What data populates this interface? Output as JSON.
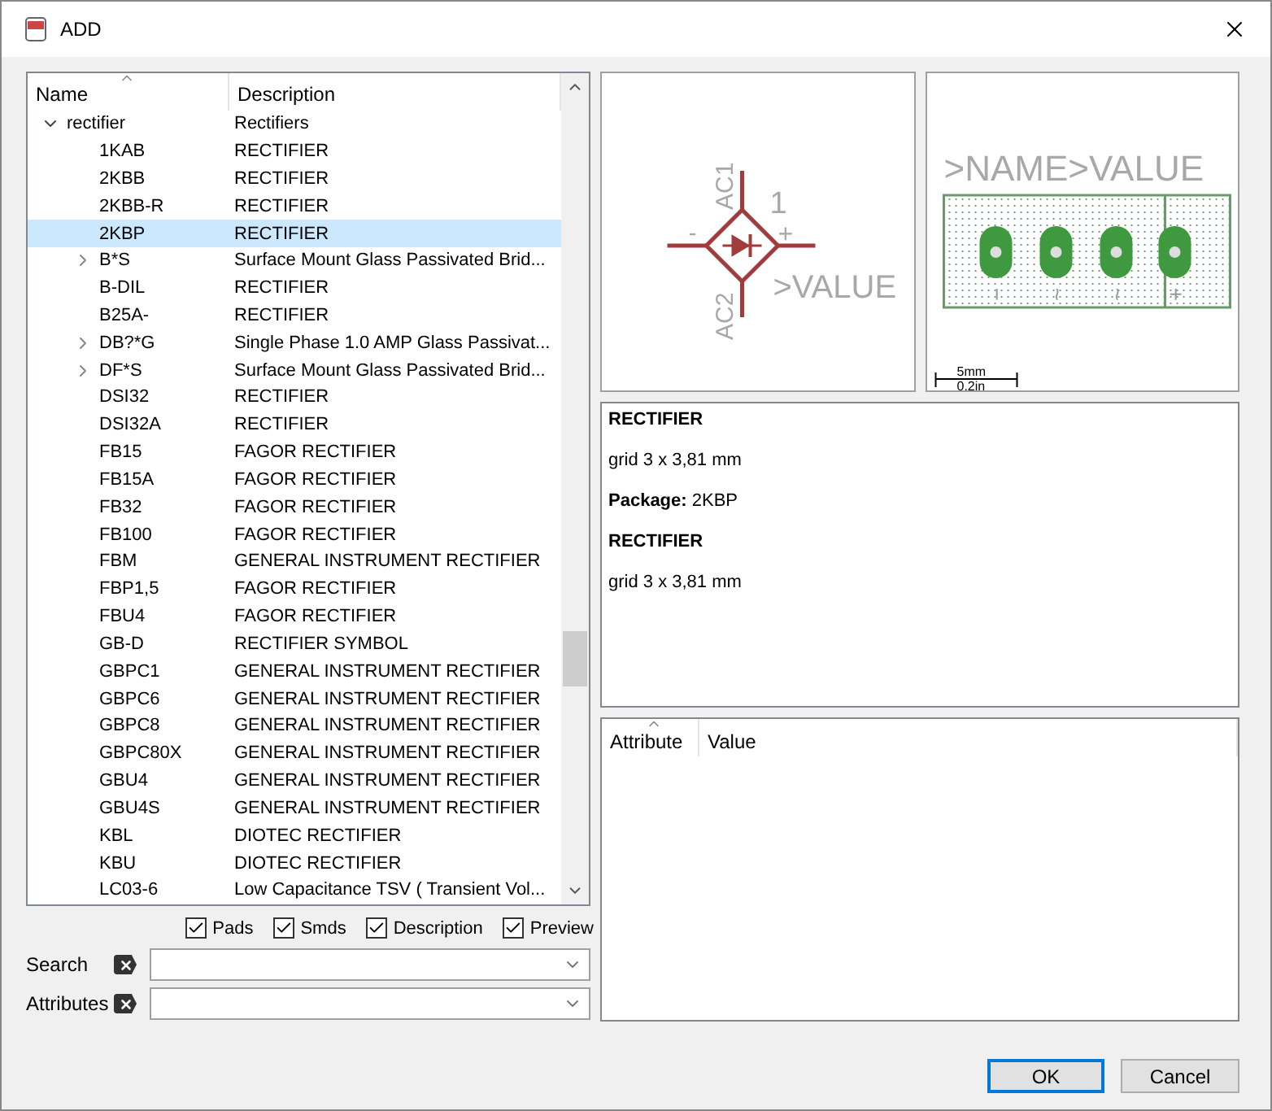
{
  "window": {
    "title": "ADD"
  },
  "tree": {
    "columns": [
      "Name",
      "Description"
    ],
    "items": [
      {
        "name": "rectifier",
        "description": "Rectifiers",
        "expanded": true,
        "selected": false,
        "children": [
          {
            "name": "1KAB",
            "description": "RECTIFIER",
            "selected": false
          },
          {
            "name": "2KBB",
            "description": "RECTIFIER",
            "selected": false
          },
          {
            "name": "2KBB-R",
            "description": "RECTIFIER",
            "selected": false
          },
          {
            "name": "2KBP",
            "description": "RECTIFIER",
            "selected": true
          },
          {
            "name": "B*S",
            "description": "Surface Mount Glass Passivated Brid...",
            "selected": false,
            "expanded": false
          },
          {
            "name": "B-DIL",
            "description": "RECTIFIER",
            "selected": false
          },
          {
            "name": "B25A-",
            "description": "RECTIFIER",
            "selected": false
          },
          {
            "name": "DB?*G",
            "description": "Single Phase 1.0 AMP Glass Passivat...",
            "selected": false,
            "expanded": false
          },
          {
            "name": "DF*S",
            "description": "Surface Mount Glass Passivated Brid...",
            "selected": false,
            "expanded": false
          },
          {
            "name": "DSI32",
            "description": "RECTIFIER",
            "selected": false
          },
          {
            "name": "DSI32A",
            "description": "RECTIFIER",
            "selected": false
          },
          {
            "name": "FB15",
            "description": "FAGOR RECTIFIER",
            "selected": false
          },
          {
            "name": "FB15A",
            "description": "FAGOR RECTIFIER",
            "selected": false
          },
          {
            "name": "FB32",
            "description": "FAGOR RECTIFIER",
            "selected": false
          },
          {
            "name": "FB100",
            "description": "FAGOR RECTIFIER",
            "selected": false
          },
          {
            "name": "FBM",
            "description": "GENERAL INSTRUMENT RECTIFIER",
            "selected": false
          },
          {
            "name": "FBP1,5",
            "description": "FAGOR RECTIFIER",
            "selected": false
          },
          {
            "name": "FBU4",
            "description": "FAGOR RECTIFIER",
            "selected": false
          },
          {
            "name": "GB-D",
            "description": "RECTIFIER SYMBOL",
            "selected": false
          },
          {
            "name": "GBPC1",
            "description": "GENERAL INSTRUMENT RECTIFIER",
            "selected": false
          },
          {
            "name": "GBPC6",
            "description": "GENERAL INSTRUMENT RECTIFIER",
            "selected": false
          },
          {
            "name": "GBPC8",
            "description": "GENERAL INSTRUMENT RECTIFIER",
            "selected": false
          },
          {
            "name": "GBPC80X",
            "description": "GENERAL INSTRUMENT RECTIFIER",
            "selected": false
          },
          {
            "name": "GBU4",
            "description": "GENERAL INSTRUMENT RECTIFIER",
            "selected": false
          },
          {
            "name": "GBU4S",
            "description": "GENERAL INSTRUMENT RECTIFIER",
            "selected": false
          },
          {
            "name": "KBL",
            "description": "DIOTEC RECTIFIER",
            "selected": false
          },
          {
            "name": "KBU",
            "description": "DIOTEC RECTIFIER",
            "selected": false
          },
          {
            "name": "LC03-6",
            "description": "Low Capacitance TSV ( Transient Vol...",
            "selected": false
          }
        ]
      }
    ]
  },
  "options": [
    {
      "label": "Pads",
      "checked": true
    },
    {
      "label": "Smds",
      "checked": true
    },
    {
      "label": "Description",
      "checked": true
    },
    {
      "label": "Preview",
      "checked": true
    }
  ],
  "filters": [
    {
      "label": "Search"
    },
    {
      "label": "Attributes"
    }
  ],
  "symbol": {
    "pin_top": "AC1",
    "pin_bottom": "AC2",
    "pin_left": "-",
    "pin_right": "+",
    "gate": "1",
    "value": ">VALUE"
  },
  "package": {
    "name": ">NAME",
    "value": ">VALUE",
    "pads": [
      "−",
      "~",
      "~",
      "+"
    ],
    "scale": [
      "5mm",
      "0.2in"
    ]
  },
  "description": [
    {
      "kind": "heading",
      "text": "RECTIFIER"
    },
    {
      "kind": "text",
      "text": "grid 3 x 3,81 mm"
    },
    {
      "kind": "text",
      "text": "**Package:** 2KBP"
    },
    {
      "kind": "heading",
      "text": "RECTIFIER"
    },
    {
      "kind": "text",
      "text": "grid 3 x 3,81 mm"
    }
  ],
  "attributes": {
    "columns": [
      "Attribute",
      "Value"
    ]
  },
  "buttons": [
    {
      "label": "OK",
      "default": true
    },
    {
      "label": "Cancel",
      "default": false
    }
  ]
}
